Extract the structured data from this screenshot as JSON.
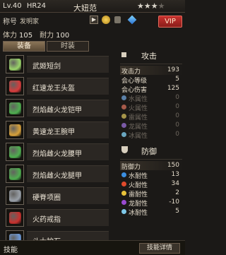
{
  "header": {
    "level": "Lv.40",
    "hr": "HR24",
    "name": "大妞范",
    "stars_filled": 3,
    "stars_total": 4
  },
  "title_row": {
    "label": "称号",
    "value": "发明家",
    "vip_label": "VIP"
  },
  "stats_row": {
    "stamina_label": "体力",
    "stamina_value": "105",
    "endurance_label": "耐力",
    "endurance_value": "100"
  },
  "tabs": [
    {
      "label": "装备",
      "active": true
    },
    {
      "label": "时装",
      "active": false
    }
  ],
  "equipment": [
    {
      "name": "武姬短剑",
      "color": "#9ad46a"
    },
    {
      "name": "红速龙王头盔",
      "color": "#d63c3c"
    },
    {
      "name": "烈焰雌火龙铠甲",
      "color": "#4fae4f"
    },
    {
      "name": "黄速龙王腕甲",
      "color": "#d6a03a"
    },
    {
      "name": "烈焰雌火龙腰甲",
      "color": "#4fae4f"
    },
    {
      "name": "烈焰雌火龙腿甲",
      "color": "#4fae4f"
    },
    {
      "name": "硬脊项圈",
      "color": "#9aa0a8"
    },
    {
      "name": "火药戒指",
      "color": "#c8312e"
    },
    {
      "name": "斗士护石",
      "color": "#6e9ad8"
    }
  ],
  "attack": {
    "header": "攻击",
    "stats": [
      {
        "label": "攻击力",
        "value": "193"
      },
      {
        "label": "会心等级",
        "value": "5"
      },
      {
        "label": "会心伤害",
        "value": "125"
      }
    ],
    "elements": [
      {
        "label": "水属性",
        "value": "0",
        "color": "#5a7fa6"
      },
      {
        "label": "火属性",
        "value": "0",
        "color": "#a65a4a"
      },
      {
        "label": "雷属性",
        "value": "0",
        "color": "#a6954a"
      },
      {
        "label": "龙属性",
        "value": "0",
        "color": "#7a5aa6"
      },
      {
        "label": "冰属性",
        "value": "0",
        "color": "#6aa6c0"
      }
    ]
  },
  "defense": {
    "header": "防御",
    "stats": [
      {
        "label": "防御力",
        "value": "150"
      }
    ],
    "elements": [
      {
        "label": "水耐性",
        "value": "13",
        "color": "#3b8ee0"
      },
      {
        "label": "火耐性",
        "value": "34",
        "color": "#e04a2c"
      },
      {
        "label": "雷耐性",
        "value": "2",
        "color": "#e8c23a"
      },
      {
        "label": "龙耐性",
        "value": "-10",
        "color": "#9a4ad0"
      },
      {
        "label": "冰耐性",
        "value": "5",
        "color": "#7ec8e8"
      }
    ]
  },
  "footer": {
    "label": "技能",
    "button": "技能详情"
  }
}
